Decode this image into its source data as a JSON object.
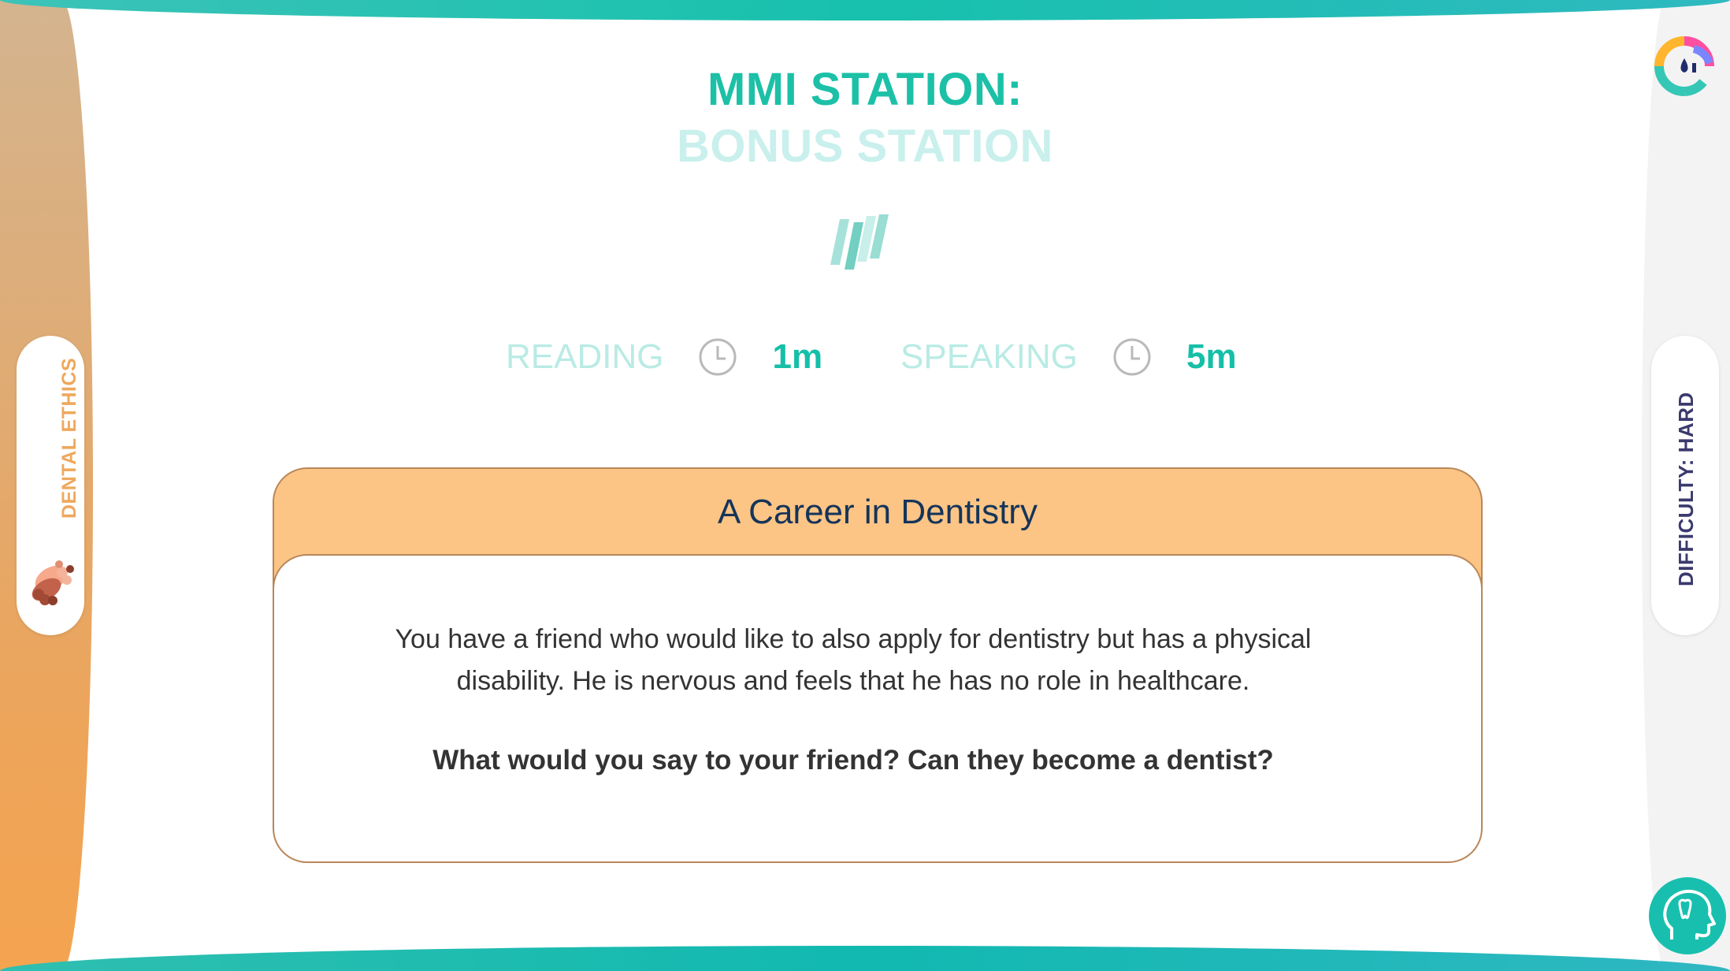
{
  "sidebar_left": {
    "category_label": "DENTAL ETHICS",
    "category_icon": "hands-icon"
  },
  "sidebar_right": {
    "difficulty_label": "DIFFICULTY: HARD"
  },
  "header": {
    "title_line1": "MMI STATION:",
    "title_line2": "BONUS STATION",
    "station_icon": "stripes-icon"
  },
  "timers": {
    "reading": {
      "label": "READING",
      "value": "1m",
      "icon": "clock-icon"
    },
    "speaking": {
      "label": "SPEAKING",
      "value": "5m",
      "icon": "clock-icon"
    }
  },
  "card": {
    "title": "A Career in Dentistry",
    "scenario": "You have a friend who would like to also apply for dentistry but has a physical disability. He is nervous and feels that he has no role in healthcare.",
    "question": "What would you say to your friend? Can they become a dentist?"
  },
  "colors": {
    "accent": "#1cc0a7",
    "accent_light": "#c9f0ec",
    "card_header": "#fcc585",
    "category": "#eea85d",
    "difficulty": "#3b3a6e"
  }
}
